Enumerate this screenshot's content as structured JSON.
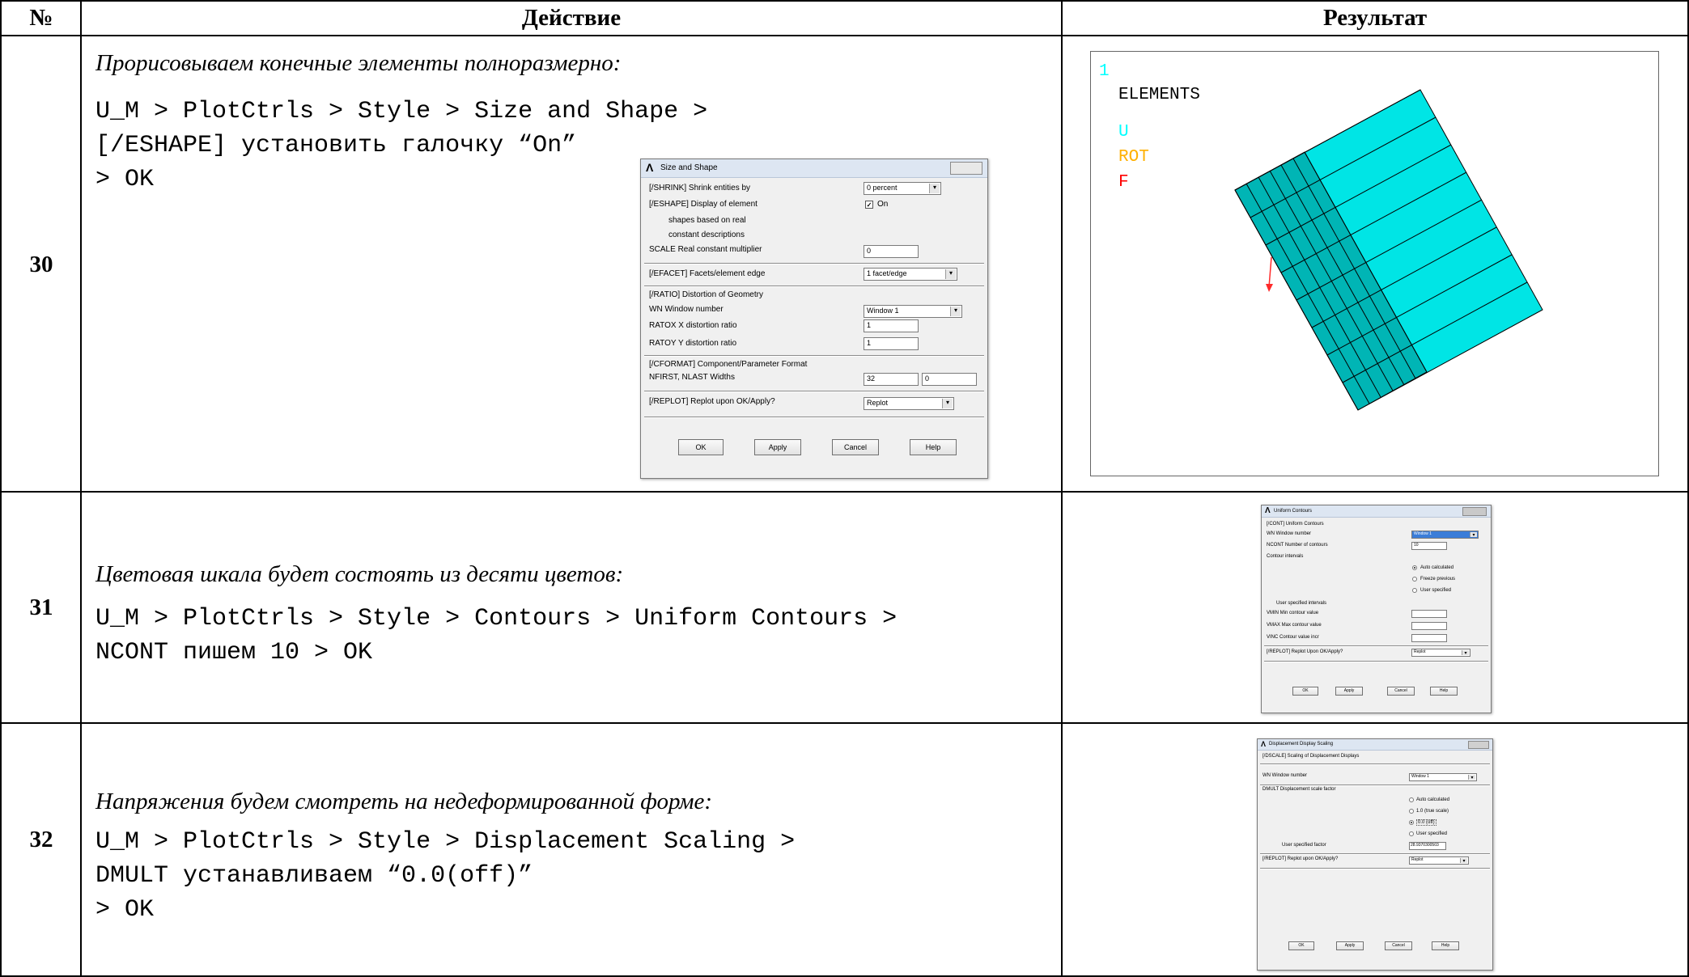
{
  "table": {
    "headers": {
      "num": "№",
      "action": "Действие",
      "result": "Результат"
    },
    "rows": [
      {
        "num": "30",
        "action_title": "Прорисовываем конечные элементы полноразмерно:",
        "command_lines": [
          "U_M > PlotCtrls > Style > Size and Shape >",
          "[/ESHAPE] установить галочку “On”",
          "> OK"
        ]
      },
      {
        "num": "31",
        "action_title": "Цветовая шкала будет состоять из десяти цветов:",
        "command_lines": [
          "U_M > PlotCtrls > Style > Contours > Uniform Contours >",
          "NCONT пишем 10 > OK"
        ]
      },
      {
        "num": "32",
        "action_title": "Напряжения будем смотреть на недеформированной форме:",
        "command_lines": [
          "U_M > PlotCtrls > Style > Displacement Scaling >",
          "DMULT устанавливаем “0.0(off)”",
          "> OK"
        ]
      }
    ]
  },
  "size_shape_dialog": {
    "title": "Size and Shape",
    "shrink_label": "[/SHRINK]  Shrink entities by",
    "shrink_value": "0 percent",
    "eshape_label": "[/ESHAPE]  Display of element",
    "eshape_sub1": "shapes based on real",
    "eshape_sub2": "constant descriptions",
    "eshape_check_mark": "✓",
    "eshape_value": "On",
    "scale_label": "SCALE   Real constant multiplier",
    "scale_value": "0",
    "efacet_label": "[/EFACET]  Facets/element edge",
    "efacet_value": "1 facet/edge",
    "ratio_label": "[/RATIO]  Distortion of Geometry",
    "wn_label": "WN       Window number",
    "wn_value": "Window 1",
    "ratiox_label": "RATOX    X distortion ratio",
    "ratiox_value": "1",
    "ratioy_label": "RATOY    Y distortion ratio",
    "ratioy_value": "1",
    "cformat_label": "[/CFORMAT]  Component/Parameter Format",
    "nfirst_label": "NFIRST, NLAST Widths",
    "nfirst_value": "32",
    "nlast_value": "0",
    "replot_label": "[/REPLOT]  Replot upon OK/Apply?",
    "replot_value": "Replot",
    "buttons": [
      "OK",
      "Apply",
      "Cancel",
      "Help"
    ]
  },
  "graphics_window": {
    "window_num": "1",
    "title": "ELEMENTS",
    "legend": [
      {
        "text": "U",
        "color": "#00ffff"
      },
      {
        "text": "ROT",
        "color": "#ffb000"
      },
      {
        "text": "F",
        "color": "#ff0000"
      }
    ],
    "mesh_fill": "#00e5e5",
    "mesh_fill_dark": "#00b5b5"
  },
  "contours_dialog": {
    "title": "Uniform Contours",
    "section": "[/CONT]  Uniform Contours",
    "wn_label": "WN    Window number",
    "wn_value": "Window 1",
    "ncont_label": "NCONT  Number of contours",
    "ncont_value": "10",
    "intervals_label": "Contour intervals",
    "options": [
      "Auto calculated",
      "Freeze previous",
      "User specified"
    ],
    "user_intervals_label": "User specified intervals",
    "vmin_label": "VMIN   Min contour value",
    "vmax_label": "VMAX   Max contour value",
    "vinc_label": "VINC   Contour value incr",
    "replot_label": "[/REPLOT]  Replot Upon OK/Apply?",
    "replot_value": "Replot",
    "buttons": [
      "OK",
      "Apply",
      "Cancel",
      "Help"
    ]
  },
  "dscale_dialog": {
    "title": "Displacement Display Scaling",
    "section": "[/DSCALE]  Scaling of Displacement Displays",
    "wn_label": "WN    Window number",
    "wn_value": "Window 1",
    "dmult_label": "DMULT  Displacement scale factor",
    "options": [
      "Auto calculated",
      "1.0 (true scale)",
      "0.0 (off)",
      "User specified"
    ],
    "user_factor_label": "User specified factor",
    "user_factor_value": "28.9370300503",
    "replot_label": "[/REPLOT]  Replot upon OK/Apply?",
    "replot_value": "Replot",
    "buttons": [
      "OK",
      "Apply",
      "Cancel",
      "Help"
    ]
  }
}
